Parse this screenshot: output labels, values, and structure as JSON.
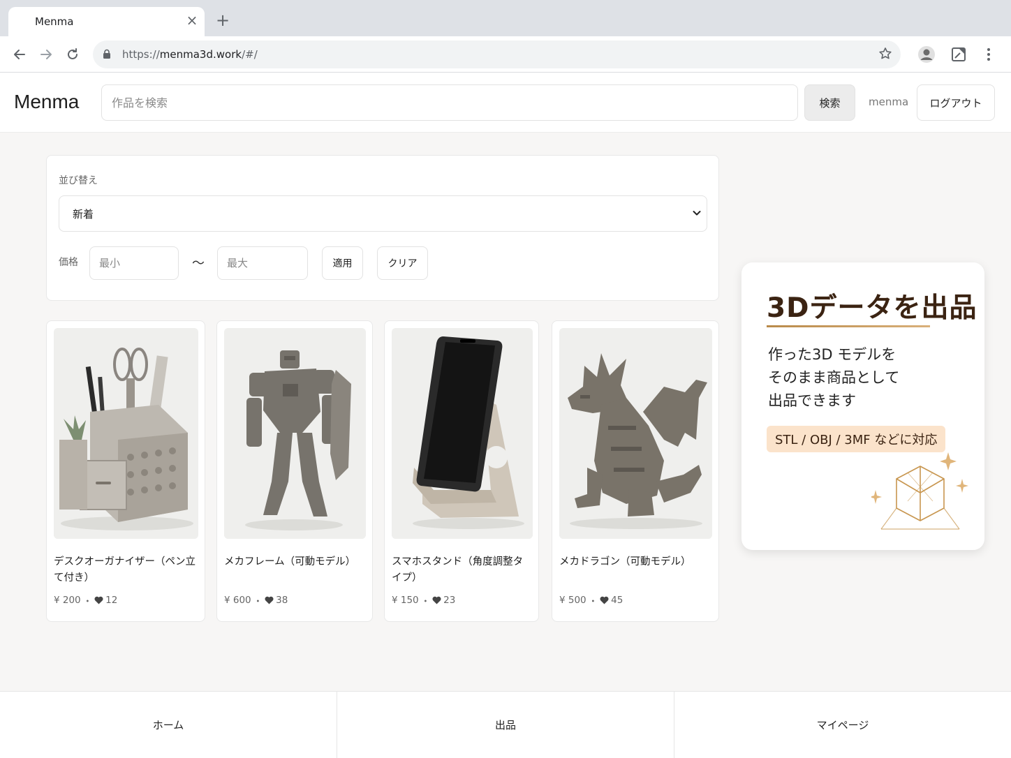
{
  "browser": {
    "tab_title": "Menma",
    "url_scheme": "https://",
    "url_host": "menma3d.work",
    "url_path": "/#/",
    "icons": [
      "back-icon",
      "forward-icon",
      "reload-icon",
      "lock-icon",
      "star-icon",
      "profile-icon",
      "extension-icon",
      "menu-icon"
    ]
  },
  "header": {
    "logo": "Menma",
    "search_placeholder": "作品を検索",
    "search_button": "検索",
    "username": "menma",
    "logout_button": "ログアウト"
  },
  "filters": {
    "sort_label": "並び替え",
    "sort_value": "新着",
    "price_label": "価格",
    "min_placeholder": "最小",
    "range_separator": "〜",
    "max_placeholder": "最大",
    "apply_button": "適用",
    "clear_button": "クリア"
  },
  "products": [
    {
      "title": "デスクオーガナイザー（ペン立て付き）",
      "price": "¥ 200",
      "likes": "12",
      "image": "desk-organizer"
    },
    {
      "title": "メカフレーム（可動モデル）",
      "price": "¥ 600",
      "likes": "38",
      "image": "mecha-robot"
    },
    {
      "title": "スマホスタンド（角度調整タイプ）",
      "price": "¥ 150",
      "likes": "23",
      "image": "phone-stand"
    },
    {
      "title": "メカドラゴン（可動モデル）",
      "price": "¥ 500",
      "likes": "45",
      "image": "mecha-dragon"
    }
  ],
  "promo": {
    "title": "3Dデータを出品",
    "body_line1": "作った3D モデルを",
    "body_line2": "そのまま商品として",
    "body_line3": "出品できます",
    "badge": "STL / OBJ / 3MF などに対応",
    "accent_color": "#c8964f"
  },
  "bottom_nav": {
    "home": "ホーム",
    "sell": "出品",
    "mypage": "マイページ"
  }
}
